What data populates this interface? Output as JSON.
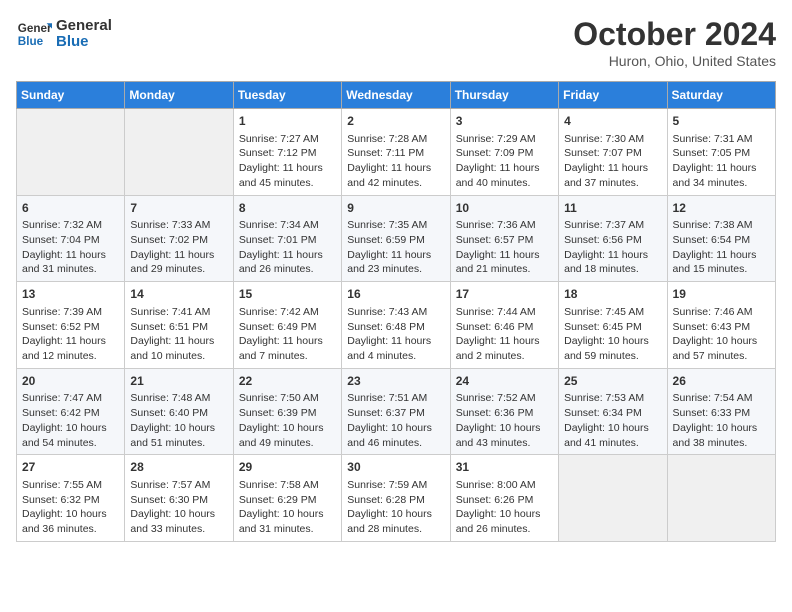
{
  "logo": {
    "line1": "General",
    "line2": "Blue"
  },
  "title": "October 2024",
  "location": "Huron, Ohio, United States",
  "days_of_week": [
    "Sunday",
    "Monday",
    "Tuesday",
    "Wednesday",
    "Thursday",
    "Friday",
    "Saturday"
  ],
  "weeks": [
    [
      {
        "day": "",
        "info": ""
      },
      {
        "day": "",
        "info": ""
      },
      {
        "day": "1",
        "info": "Sunrise: 7:27 AM\nSunset: 7:12 PM\nDaylight: 11 hours and 45 minutes."
      },
      {
        "day": "2",
        "info": "Sunrise: 7:28 AM\nSunset: 7:11 PM\nDaylight: 11 hours and 42 minutes."
      },
      {
        "day": "3",
        "info": "Sunrise: 7:29 AM\nSunset: 7:09 PM\nDaylight: 11 hours and 40 minutes."
      },
      {
        "day": "4",
        "info": "Sunrise: 7:30 AM\nSunset: 7:07 PM\nDaylight: 11 hours and 37 minutes."
      },
      {
        "day": "5",
        "info": "Sunrise: 7:31 AM\nSunset: 7:05 PM\nDaylight: 11 hours and 34 minutes."
      }
    ],
    [
      {
        "day": "6",
        "info": "Sunrise: 7:32 AM\nSunset: 7:04 PM\nDaylight: 11 hours and 31 minutes."
      },
      {
        "day": "7",
        "info": "Sunrise: 7:33 AM\nSunset: 7:02 PM\nDaylight: 11 hours and 29 minutes."
      },
      {
        "day": "8",
        "info": "Sunrise: 7:34 AM\nSunset: 7:01 PM\nDaylight: 11 hours and 26 minutes."
      },
      {
        "day": "9",
        "info": "Sunrise: 7:35 AM\nSunset: 6:59 PM\nDaylight: 11 hours and 23 minutes."
      },
      {
        "day": "10",
        "info": "Sunrise: 7:36 AM\nSunset: 6:57 PM\nDaylight: 11 hours and 21 minutes."
      },
      {
        "day": "11",
        "info": "Sunrise: 7:37 AM\nSunset: 6:56 PM\nDaylight: 11 hours and 18 minutes."
      },
      {
        "day": "12",
        "info": "Sunrise: 7:38 AM\nSunset: 6:54 PM\nDaylight: 11 hours and 15 minutes."
      }
    ],
    [
      {
        "day": "13",
        "info": "Sunrise: 7:39 AM\nSunset: 6:52 PM\nDaylight: 11 hours and 12 minutes."
      },
      {
        "day": "14",
        "info": "Sunrise: 7:41 AM\nSunset: 6:51 PM\nDaylight: 11 hours and 10 minutes."
      },
      {
        "day": "15",
        "info": "Sunrise: 7:42 AM\nSunset: 6:49 PM\nDaylight: 11 hours and 7 minutes."
      },
      {
        "day": "16",
        "info": "Sunrise: 7:43 AM\nSunset: 6:48 PM\nDaylight: 11 hours and 4 minutes."
      },
      {
        "day": "17",
        "info": "Sunrise: 7:44 AM\nSunset: 6:46 PM\nDaylight: 11 hours and 2 minutes."
      },
      {
        "day": "18",
        "info": "Sunrise: 7:45 AM\nSunset: 6:45 PM\nDaylight: 10 hours and 59 minutes."
      },
      {
        "day": "19",
        "info": "Sunrise: 7:46 AM\nSunset: 6:43 PM\nDaylight: 10 hours and 57 minutes."
      }
    ],
    [
      {
        "day": "20",
        "info": "Sunrise: 7:47 AM\nSunset: 6:42 PM\nDaylight: 10 hours and 54 minutes."
      },
      {
        "day": "21",
        "info": "Sunrise: 7:48 AM\nSunset: 6:40 PM\nDaylight: 10 hours and 51 minutes."
      },
      {
        "day": "22",
        "info": "Sunrise: 7:50 AM\nSunset: 6:39 PM\nDaylight: 10 hours and 49 minutes."
      },
      {
        "day": "23",
        "info": "Sunrise: 7:51 AM\nSunset: 6:37 PM\nDaylight: 10 hours and 46 minutes."
      },
      {
        "day": "24",
        "info": "Sunrise: 7:52 AM\nSunset: 6:36 PM\nDaylight: 10 hours and 43 minutes."
      },
      {
        "day": "25",
        "info": "Sunrise: 7:53 AM\nSunset: 6:34 PM\nDaylight: 10 hours and 41 minutes."
      },
      {
        "day": "26",
        "info": "Sunrise: 7:54 AM\nSunset: 6:33 PM\nDaylight: 10 hours and 38 minutes."
      }
    ],
    [
      {
        "day": "27",
        "info": "Sunrise: 7:55 AM\nSunset: 6:32 PM\nDaylight: 10 hours and 36 minutes."
      },
      {
        "day": "28",
        "info": "Sunrise: 7:57 AM\nSunset: 6:30 PM\nDaylight: 10 hours and 33 minutes."
      },
      {
        "day": "29",
        "info": "Sunrise: 7:58 AM\nSunset: 6:29 PM\nDaylight: 10 hours and 31 minutes."
      },
      {
        "day": "30",
        "info": "Sunrise: 7:59 AM\nSunset: 6:28 PM\nDaylight: 10 hours and 28 minutes."
      },
      {
        "day": "31",
        "info": "Sunrise: 8:00 AM\nSunset: 6:26 PM\nDaylight: 10 hours and 26 minutes."
      },
      {
        "day": "",
        "info": ""
      },
      {
        "day": "",
        "info": ""
      }
    ]
  ]
}
